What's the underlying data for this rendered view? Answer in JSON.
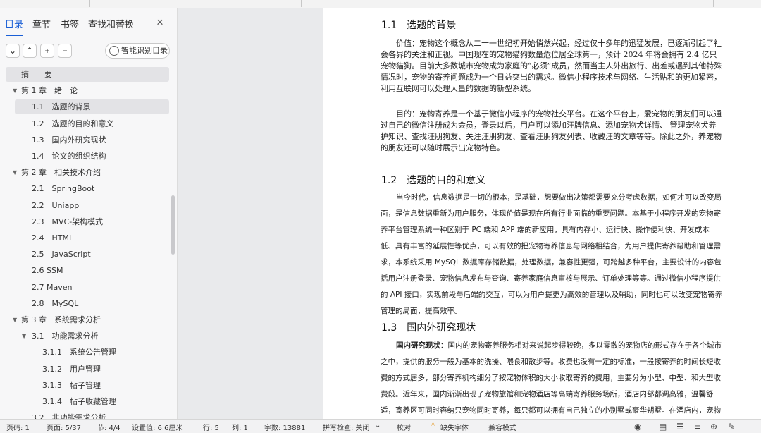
{
  "sidebar": {
    "tabs": [
      "目录",
      "章节",
      "书签",
      "查找和替换"
    ],
    "close_label": "×",
    "tools": [
      "⌄",
      "⌃",
      "+",
      "−"
    ],
    "smart_button": "智能识别目录",
    "toc": [
      {
        "label": "摘　　要",
        "level": 0,
        "caret": false
      },
      {
        "label": "第 1 章　绪　论",
        "level": 0,
        "caret": true
      },
      {
        "label": "1.1　选题的背景",
        "level": 1,
        "caret": false
      },
      {
        "label": "1.2　选题的目的和意义",
        "level": 1,
        "caret": false
      },
      {
        "label": "1.3　国内外研究现状",
        "level": 1,
        "caret": false
      },
      {
        "label": "1.4　论文的组织结构",
        "level": 1,
        "caret": false
      },
      {
        "label": "第 2 章　相关技术介绍",
        "level": 0,
        "caret": true
      },
      {
        "label": "2.1　SpringBoot",
        "level": 1,
        "caret": false
      },
      {
        "label": "2.2　Uniapp",
        "level": 1,
        "caret": false
      },
      {
        "label": "2.3　MVC-架构模式",
        "level": 1,
        "caret": false
      },
      {
        "label": "2.4　HTML",
        "level": 1,
        "caret": false
      },
      {
        "label": "2.5　JavaScript",
        "level": 1,
        "caret": false
      },
      {
        "label": "2.6 SSM",
        "level": 1,
        "caret": false
      },
      {
        "label": "2.7 Maven",
        "level": 1,
        "caret": false
      },
      {
        "label": "2.8　MySQL",
        "level": 1,
        "caret": false
      },
      {
        "label": "第 3 章　系统需求分析",
        "level": 0,
        "caret": true
      },
      {
        "label": "3.1　功能需求分析",
        "level": 1,
        "caret": true
      },
      {
        "label": "3.1.1　系统公告管理",
        "level": 2,
        "caret": false
      },
      {
        "label": "3.1.2　用户管理",
        "level": 2,
        "caret": false
      },
      {
        "label": "3.1.3　帖子管理",
        "level": 2,
        "caret": false
      },
      {
        "label": "3.1.4　帖子收藏管理",
        "level": 2,
        "caret": false
      },
      {
        "label": "3.2　非功能需求分析",
        "level": 1,
        "caret": false
      }
    ],
    "selected_index": 2
  },
  "document": {
    "heading_marker": "H₂",
    "drag_handle": "⠿",
    "sections": [
      {
        "heading": "1.1　选题的背景",
        "paragraphs": [
          "价值：宠物这个概念从二十一世纪初开始悄然兴起，经过仅十多年的迅猛发展，已逐渐引起了社会各界的关注和正视。中国现在的宠物猫狗数量危位居全球第一，预计 2024 年将会拥有 2.4 亿只宠物猫狗。目前大多数城市宠物成为家庭的“必须”成员，然而当主人外出旅行、出差或遇到其他特殊情况时，宠物的寄养问题成为一个日益突出的需求。微信小程序技术与网络、生活贴和的更加紧密，利用互联网可以处理大量的数据的新型系统。",
          "目的：宠物寄养是一个基于微信小程序的宠物社交平台。在这个平台上，爱宠物的朋友们可以通过自己的微信注册成为会员，登录以后，用户可以添加汪牌信息、添加宠物犬详情、 管理宠物犬养护知识、查找汪朋狗友、关注汪朋狗友、查看汪朋狗友列表、收藏汪的文章等等。除此之外，养宠物的朋友还可以随时展示出宠物特色。"
        ]
      },
      {
        "heading": "1.2　选题的目的和意义",
        "paragraphs": [
          "当今时代，信息数据是一切的根本，是基础，想要做出决策都需要充分考虑数据，如何才可以改变局面，是信息数据重新为用户服务，体现价值是现在所有行业面临的重要问题。本基于小程序开发的宠物寄养平台管理系统一种区别于 PC 端和 APP 端的新应用，具有内存小、运行快、操作便利快、开发成本低、具有丰富的延展性等优点，可以有效的把宠物寄养信息与网络相结合，为用户提供寄养帮助和管理需求，本系统采用 MySQL 数据库存储数据，处理数据，兼容性更强，可跨越多种平台，主要设计的内容包括用户注册登录、宠物信息发布与查询、寄养家庭信息审核与展示、订单处理等等。通过微信小程序提供的 API 接口，实现前段与后端的交互，可以为用户提更为高效的管理以及辅助，同时也可以改变宠物寄养管理的局面，提高效率。"
        ]
      },
      {
        "heading": "1.3　国内外研究现状",
        "lead": "国内研究现状：",
        "paragraphs": [
          "国内的宠物寄养服务相对来说起步得较晚，多以零散的宠物店的形式存在于各个城市之中，提供的服务一般为基本的洗操、喂食和散步等。收费也没有一定的标准，一般按寄养的时间长短收费的方式居多，部分寄养机构细分了按宠物体积的大小收取寄养的费用，主要分为小型、中型、和大型收费段。近年来，国内渐渐出现了宠物旅馆和宠物酒店等高端寄养服务场所，酒店内部都调高雅，温馨舒适，寄养区可同时容纳只宠物同时寄养，每只都可以拥有自己独立的小别墅或豪华朔墅。在酒店内，宠物们不仅能得到协调的管养"
        ]
      }
    ]
  },
  "status": {
    "page_count": "页码: 1",
    "page": "页面: 5/37",
    "section": "节: 4/4",
    "setting": "设置值: 6.6厘米",
    "row": "行: 5",
    "col": "列: 1",
    "words": "字数: 13881",
    "spell": "拼写检查: 关闭",
    "spell_caret": "⌄",
    "proof": "校对",
    "font_warn": "缺失字体",
    "compat": "兼容模式"
  }
}
